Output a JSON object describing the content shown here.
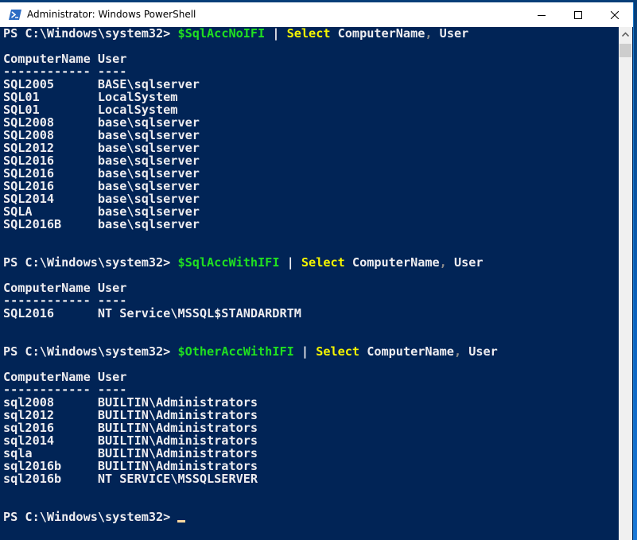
{
  "window": {
    "title": "Administrator: Windows PowerShell",
    "icons": {
      "app": "powershell-icon",
      "minimize": "minimize-icon",
      "maximize": "maximize-icon",
      "close": "close-icon",
      "scroll_up": "chevron-up-icon"
    }
  },
  "console": {
    "prompt": "PS C:\\Windows\\system32> ",
    "blocks": [
      {
        "command": {
          "variable": "$SqlAccNoIFI",
          "pipe": " | ",
          "cmdlet": "Select",
          "args": " ComputerName",
          "comma": ",",
          "args2": " User"
        },
        "header": "ComputerName User",
        "separator": "------------ ----",
        "rows": [
          [
            "SQL2005",
            "BASE\\sqlserver"
          ],
          [
            "SQL01",
            "LocalSystem"
          ],
          [
            "SQL01",
            "LocalSystem"
          ],
          [
            "SQL2008",
            "base\\sqlserver"
          ],
          [
            "SQL2008",
            "base\\sqlserver"
          ],
          [
            "SQL2012",
            "base\\sqlserver"
          ],
          [
            "SQL2016",
            "base\\sqlserver"
          ],
          [
            "SQL2016",
            "base\\sqlserver"
          ],
          [
            "SQL2016",
            "base\\sqlserver"
          ],
          [
            "SQL2014",
            "base\\sqlserver"
          ],
          [
            "SQLA",
            "base\\sqlserver"
          ],
          [
            "SQL2016B",
            "base\\sqlserver"
          ]
        ]
      },
      {
        "command": {
          "variable": "$SqlAccWithIFI",
          "pipe": " | ",
          "cmdlet": "Select",
          "args": " ComputerName",
          "comma": ",",
          "args2": " User"
        },
        "header": "ComputerName User",
        "separator": "------------ ----",
        "rows": [
          [
            "SQL2016",
            "NT Service\\MSSQL$STANDARDRTM"
          ]
        ]
      },
      {
        "command": {
          "variable": "$OtherAccWithIFI",
          "pipe": " | ",
          "cmdlet": "Select",
          "args": " ComputerName",
          "comma": ",",
          "args2": " User"
        },
        "header": "ComputerName User",
        "separator": "------------ ----",
        "rows": [
          [
            "sql2008",
            "BUILTIN\\Administrators"
          ],
          [
            "sql2012",
            "BUILTIN\\Administrators"
          ],
          [
            "sql2016",
            "BUILTIN\\Administrators"
          ],
          [
            "sql2014",
            "BUILTIN\\Administrators"
          ],
          [
            "sqla",
            "BUILTIN\\Administrators"
          ],
          [
            "sql2016b",
            "BUILTIN\\Administrators"
          ],
          [
            "sql2016b",
            "NT SERVICE\\MSSQLSERVER"
          ]
        ]
      }
    ],
    "final_prompt": "PS C:\\Windows\\system32> "
  },
  "colors": {
    "console_bg": "#012456",
    "text": "#eeedf0",
    "variable": "#20e020",
    "cmdlet": "#f5f500",
    "cursor": "#fcd9a0"
  }
}
